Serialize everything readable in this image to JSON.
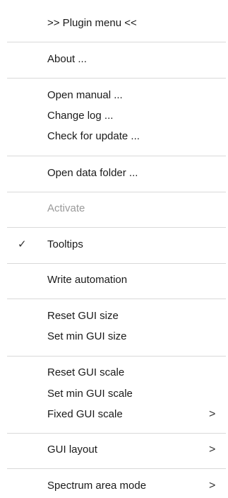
{
  "menu": {
    "header": ">> Plugin menu <<",
    "about": "About ...",
    "open_manual": "Open manual ...",
    "change_log": "Change log ...",
    "check_update": "Check for update ...",
    "open_data_folder": "Open data folder ...",
    "activate": "Activate",
    "tooltips": "Tooltips",
    "tooltips_check": "✓",
    "write_automation": "Write automation",
    "reset_gui_size": "Reset GUI size",
    "set_min_gui_size": "Set min GUI size",
    "reset_gui_scale": "Reset GUI scale",
    "set_min_gui_scale": "Set min GUI scale",
    "fixed_gui_scale": "Fixed GUI scale",
    "gui_layout": "GUI layout",
    "spectrum_area_mode": "Spectrum area mode",
    "submenu_arrow": ">"
  }
}
